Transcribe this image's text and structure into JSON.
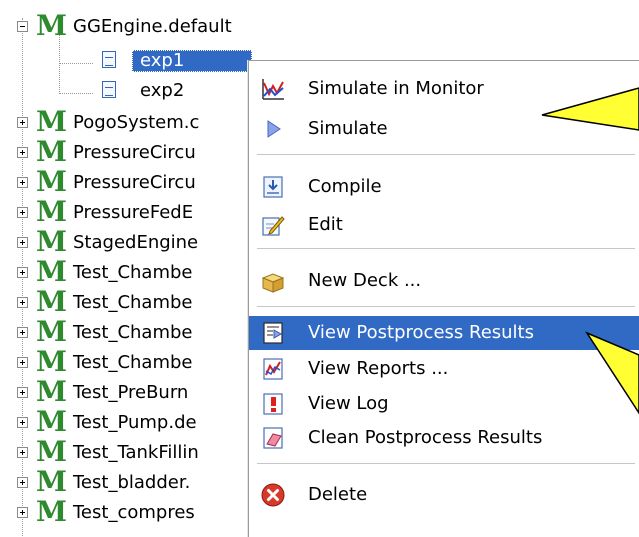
{
  "tree": {
    "rows": [
      {
        "label": "GGEngine.default",
        "type": "model",
        "expander": "minus"
      },
      {
        "label": "exp1",
        "type": "doc",
        "selected": true
      },
      {
        "label": "exp2",
        "type": "doc"
      },
      {
        "label": "PogoSystem.c",
        "type": "model",
        "expander": "plus"
      },
      {
        "label": "PressureCircu",
        "type": "model",
        "expander": "plus"
      },
      {
        "label": "PressureCircu",
        "type": "model",
        "expander": "plus"
      },
      {
        "label": "PressureFedE",
        "type": "model",
        "expander": "plus"
      },
      {
        "label": "StagedEngine",
        "type": "model",
        "expander": "plus"
      },
      {
        "label": "Test_Chambe",
        "type": "model",
        "expander": "plus"
      },
      {
        "label": "Test_Chambe",
        "type": "model",
        "expander": "plus"
      },
      {
        "label": "Test_Chambe",
        "type": "model",
        "expander": "plus"
      },
      {
        "label": "Test_Chambe",
        "type": "model",
        "expander": "plus"
      },
      {
        "label": "Test_PreBurn",
        "type": "model",
        "expander": "plus"
      },
      {
        "label": "Test_Pump.de",
        "type": "model",
        "expander": "plus"
      },
      {
        "label": "Test_TankFillin",
        "type": "model",
        "expander": "plus"
      },
      {
        "label": "Test_bladder.",
        "type": "model",
        "expander": "plus"
      },
      {
        "label": "Test_compres",
        "type": "model",
        "expander": "plus"
      }
    ],
    "model_glyph": "M"
  },
  "menu": {
    "items": [
      {
        "label": "Simulate in Monitor",
        "icon": "monitor-chart-icon"
      },
      {
        "label": "Simulate",
        "icon": "play-triangle-icon"
      },
      {
        "label": "Compile",
        "icon": "compile-icon"
      },
      {
        "label": "Edit",
        "icon": "edit-pencil-icon"
      },
      {
        "label": "New Deck ...",
        "icon": "deck-box-icon"
      },
      {
        "label": "View Postprocess Results",
        "icon": "view-results-icon",
        "highlighted": true
      },
      {
        "label": "View Reports ...",
        "icon": "reports-icon"
      },
      {
        "label": "View Log",
        "icon": "log-icon"
      },
      {
        "label": "Clean Postprocess Results",
        "icon": "clean-results-icon"
      },
      {
        "label": "Delete",
        "icon": "delete-icon"
      }
    ]
  },
  "colors": {
    "selection": "#316ac5",
    "model_green": "#2f8a2f",
    "callout_yellow": "#ffff33"
  }
}
